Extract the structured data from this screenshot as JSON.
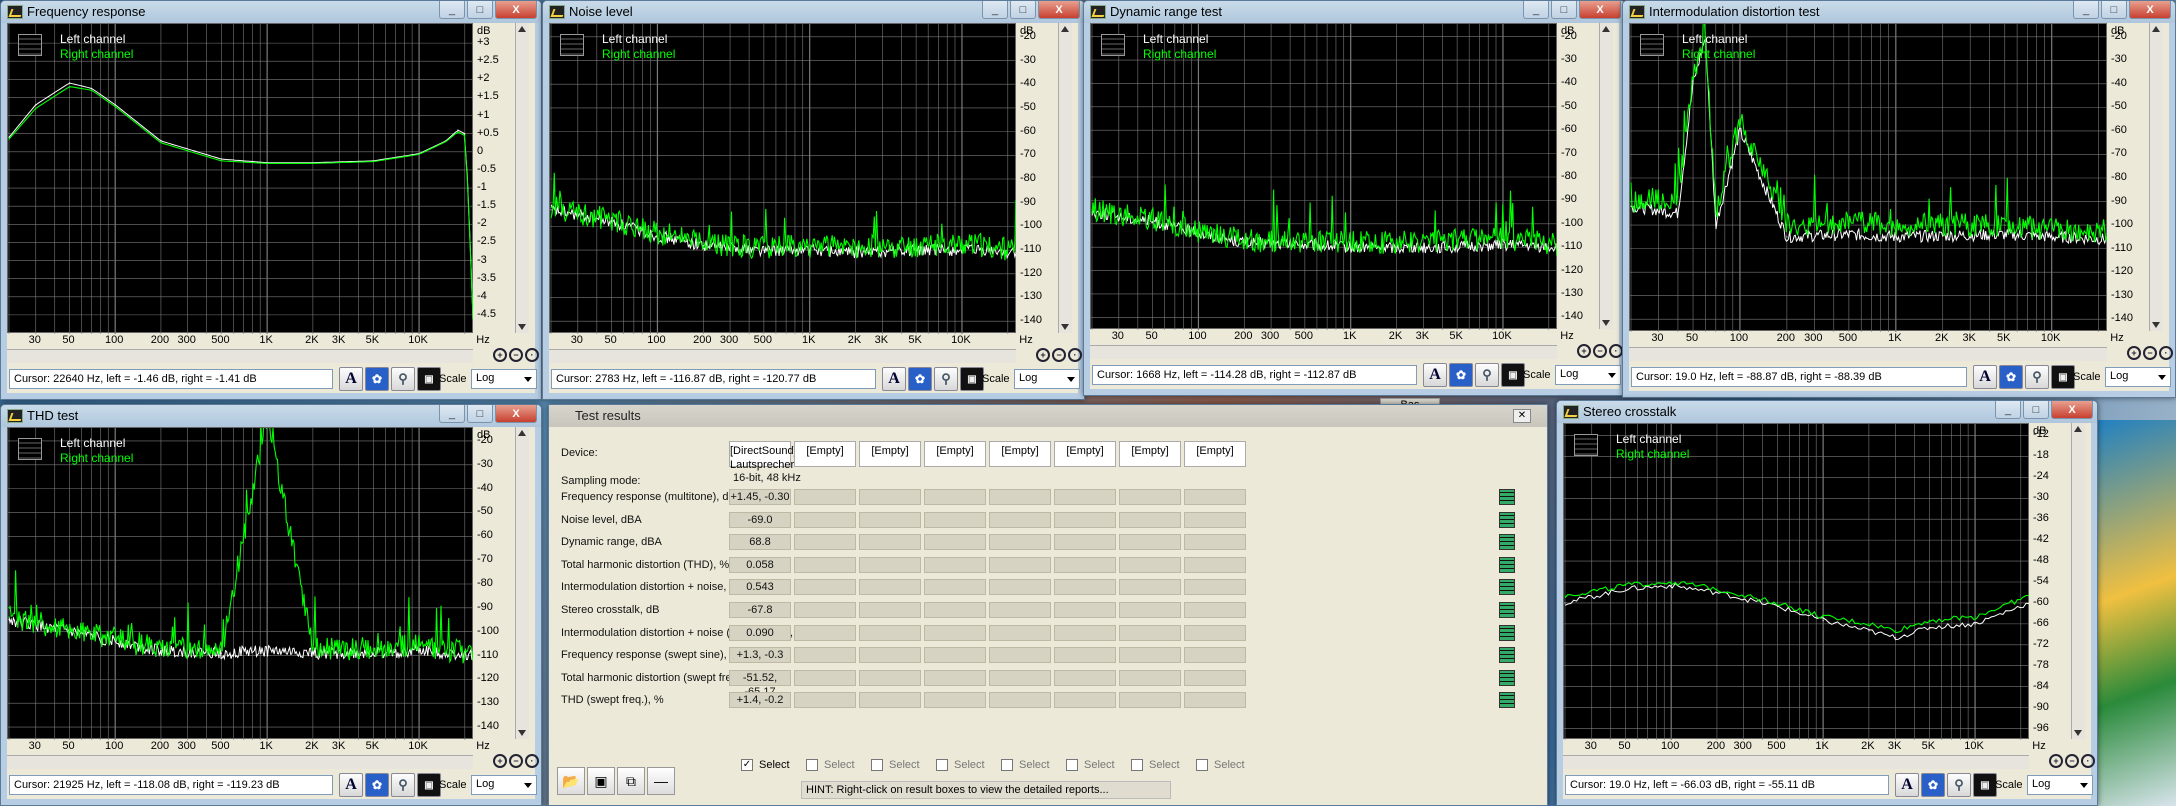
{
  "legend": {
    "left": "Left channel",
    "right": "Right channel"
  },
  "units": {
    "db": "dB",
    "hz": "Hz"
  },
  "scale_label": "Scale",
  "scale_value": "Log",
  "x_ticks": [
    "30",
    "50",
    "100",
    "200",
    "300",
    "500",
    "1K",
    "2K",
    "3K",
    "5K",
    "10K"
  ],
  "colors": {
    "left": "#ffffff",
    "right": "#00ff00",
    "grid": "#7a7a7a",
    "plot_bg": "#000000"
  },
  "window_buttons": [
    "_",
    "□",
    "X"
  ],
  "windows": {
    "freq": {
      "title": "Frequency response",
      "cursor": "Cursor:  22640 Hz,  left = -1.46 dB,  right = -1.41 dB",
      "y_ticks": [
        "+3",
        "+2.5",
        "+2",
        "+1.5",
        "+1",
        "+0.5",
        "0",
        "-0.5",
        "-1",
        "-1.5",
        "-2",
        "-2.5",
        "-3",
        "-3.5",
        "-4",
        "-4.5"
      ]
    },
    "noise": {
      "title": "Noise level",
      "cursor": "Cursor:  2783 Hz,  left = -116.87 dB,  right = -120.77 dB",
      "y_ticks": [
        "-20",
        "-30",
        "-40",
        "-50",
        "-60",
        "-70",
        "-80",
        "-90",
        "-100",
        "-110",
        "-120",
        "-130",
        "-140"
      ]
    },
    "dyn": {
      "title": "Dynamic range test",
      "cursor": "Cursor:  1668 Hz,  left = -114.28 dB,  right = -112.87 dB",
      "y_ticks": [
        "-20",
        "-30",
        "-40",
        "-50",
        "-60",
        "-70",
        "-80",
        "-90",
        "-100",
        "-110",
        "-120",
        "-130",
        "-140"
      ]
    },
    "imd": {
      "title": "Intermodulation distortion test",
      "cursor": "Cursor:  19.0 Hz,  left = -88.87 dB,  right = -88.39 dB",
      "y_ticks": [
        "-20",
        "-30",
        "-40",
        "-50",
        "-60",
        "-70",
        "-80",
        "-90",
        "-100",
        "-110",
        "-120",
        "-130",
        "-140"
      ]
    },
    "thd": {
      "title": "THD test",
      "cursor": "Cursor:  21925 Hz,  left = -118.08 dB,  right = -119.23 dB",
      "y_ticks": [
        "-20",
        "-30",
        "-40",
        "-50",
        "-60",
        "-70",
        "-80",
        "-90",
        "-100",
        "-110",
        "-120",
        "-130",
        "-140"
      ]
    },
    "xtalk": {
      "title": "Stereo crosstalk",
      "cursor": "Cursor:  19.0 Hz,  left = -66.03 dB,  right = -55.11 dB",
      "y_ticks": [
        "-12",
        "-18",
        "-24",
        "-30",
        "-36",
        "-42",
        "-48",
        "-54",
        "-60",
        "-66",
        "-72",
        "-78",
        "-84",
        "-90",
        "-96"
      ]
    }
  },
  "results": {
    "title": "Test results",
    "device_label": "Device:",
    "device_name": "[DirectSound] Lautsprecher",
    "empty": "[Empty]",
    "sampling_label": "Sampling mode:",
    "sampling_value": "16-bit, 48 kHz",
    "rows": [
      {
        "label": "Frequency response (multitone), dB",
        "value": "+1.45, -0.30"
      },
      {
        "label": "Noise level, dBA",
        "value": "-69.0"
      },
      {
        "label": "Dynamic range, dBA",
        "value": "68.8"
      },
      {
        "label": "Total harmonic distortion (THD), %",
        "value": "0.058"
      },
      {
        "label": "Intermodulation distortion + noise, %",
        "value": "0.543"
      },
      {
        "label": "Stereo crosstalk, dB",
        "value": "-67.8"
      },
      {
        "label": "Intermodulation distortion + noise (swept freqs), %",
        "value": "0.090"
      },
      {
        "label": "Frequency response (swept sine), dB",
        "value": "+1.3, -0.3"
      },
      {
        "label": "Total harmonic distortion (swept freqs), дБ",
        "value": "-51.52, -65.17"
      },
      {
        "label": "THD (swept freq.), %",
        "value": "+1.4, -0.2"
      }
    ],
    "select": "Select",
    "hint": "HINT: Right-click on result boxes to view the detailed reports..."
  },
  "chart_data": [
    {
      "type": "line",
      "title": "Frequency response",
      "xscale": "log",
      "xlim": [
        20,
        22640
      ],
      "ylim": [
        -5,
        3.5
      ],
      "ylabel": "dB",
      "series": [
        {
          "name": "Left channel",
          "x": [
            20,
            30,
            50,
            70,
            100,
            200,
            500,
            1000,
            2000,
            5000,
            10000,
            15000,
            18000,
            20000,
            21000,
            22640
          ],
          "y": [
            0.4,
            1.3,
            1.9,
            1.75,
            1.3,
            0.3,
            -0.2,
            -0.3,
            -0.3,
            -0.25,
            -0.05,
            0.3,
            0.6,
            0.5,
            -1.0,
            -4.6
          ]
        },
        {
          "name": "Right channel",
          "x": [
            20,
            30,
            50,
            70,
            100,
            200,
            500,
            1000,
            2000,
            5000,
            10000,
            15000,
            18000,
            20000,
            21000,
            22640
          ],
          "y": [
            0.35,
            1.2,
            1.8,
            1.7,
            1.25,
            0.25,
            -0.25,
            -0.32,
            -0.32,
            -0.27,
            -0.07,
            0.28,
            0.55,
            0.45,
            -1.1,
            -4.6
          ]
        }
      ]
    },
    {
      "type": "line",
      "title": "Noise level",
      "xscale": "log",
      "xlim": [
        20,
        22640
      ],
      "ylim": [
        -145,
        -15
      ],
      "ylabel": "dB",
      "series": [
        {
          "name": "Left channel",
          "x": [
            20,
            50,
            100,
            200,
            500,
            1000,
            2000,
            5000,
            10000,
            22640
          ],
          "y": [
            -93,
            -98,
            -104,
            -108,
            -110,
            -110,
            -111,
            -110,
            -110,
            -111
          ]
        },
        {
          "name": "Right channel",
          "x": [
            20,
            50,
            100,
            200,
            500,
            1000,
            2000,
            5000,
            10000,
            22640
          ],
          "y": [
            -92,
            -97,
            -103,
            -107,
            -109,
            -108,
            -109,
            -108,
            -107,
            -110
          ]
        }
      ]
    },
    {
      "type": "line",
      "title": "Dynamic range test",
      "xscale": "log",
      "xlim": [
        20,
        22640
      ],
      "ylim": [
        -145,
        -15
      ],
      "ylabel": "dB",
      "series": [
        {
          "name": "Left channel",
          "x": [
            20,
            50,
            100,
            200,
            500,
            1000,
            2000,
            5000,
            10000,
            22640
          ],
          "y": [
            -95,
            -99,
            -104,
            -108,
            -109,
            -110,
            -110,
            -110,
            -109,
            -110
          ]
        },
        {
          "name": "Right channel",
          "x": [
            20,
            50,
            100,
            200,
            500,
            1000,
            2000,
            5000,
            10000,
            22640
          ],
          "y": [
            -94,
            -98,
            -103,
            -107,
            -108,
            -108,
            -108,
            -107,
            -106,
            -109
          ]
        }
      ]
    },
    {
      "type": "line",
      "title": "Intermodulation distortion test",
      "xscale": "log",
      "xlim": [
        20,
        22640
      ],
      "ylim": [
        -145,
        -15
      ],
      "ylabel": "dB",
      "series": [
        {
          "name": "Left channel",
          "x": [
            20,
            40,
            50,
            60,
            70,
            100,
            200,
            500,
            1000,
            5000,
            22640
          ],
          "y": [
            -92,
            -95,
            -40,
            -20,
            -100,
            -60,
            -105,
            -104,
            -105,
            -104,
            -106
          ]
        },
        {
          "name": "Right channel",
          "x": [
            20,
            40,
            50,
            60,
            70,
            100,
            200,
            500,
            1000,
            5000,
            22640
          ],
          "y": [
            -90,
            -88,
            -38,
            -18,
            -95,
            -55,
            -100,
            -99,
            -100,
            -100,
            -104
          ]
        }
      ]
    },
    {
      "type": "line",
      "title": "THD test",
      "xscale": "log",
      "xlim": [
        20,
        22640
      ],
      "ylim": [
        -145,
        -15
      ],
      "ylabel": "dB",
      "series": [
        {
          "name": "Left channel",
          "x": [
            20,
            50,
            100,
            200,
            500,
            1000,
            2000,
            5000,
            10000,
            22640
          ],
          "y": [
            -95,
            -100,
            -104,
            -108,
            -109,
            -108,
            -109,
            -109,
            -108,
            -110
          ]
        },
        {
          "name": "Right channel",
          "x": [
            20,
            50,
            100,
            200,
            500,
            1000,
            2000,
            5000,
            10000,
            22640
          ],
          "y": [
            -94,
            -99,
            -103,
            -107,
            -108,
            -10,
            -107,
            -107,
            -106,
            -109
          ]
        }
      ]
    },
    {
      "type": "line",
      "title": "Stereo crosstalk",
      "xscale": "log",
      "xlim": [
        20,
        22640
      ],
      "ylim": [
        -99,
        -9
      ],
      "ylabel": "dB",
      "series": [
        {
          "name": "Left channel",
          "x": [
            20,
            50,
            100,
            200,
            500,
            1000,
            2000,
            3000,
            5000,
            10000,
            22640
          ],
          "y": [
            -60,
            -56,
            -55,
            -57,
            -61,
            -65,
            -68,
            -70,
            -67,
            -66,
            -60
          ]
        },
        {
          "name": "Right channel",
          "x": [
            20,
            50,
            100,
            200,
            500,
            1000,
            2000,
            3000,
            5000,
            10000,
            22640
          ],
          "y": [
            -58,
            -55,
            -54,
            -56,
            -60,
            -64,
            -66,
            -68,
            -65,
            -64,
            -58
          ]
        }
      ]
    }
  ]
}
